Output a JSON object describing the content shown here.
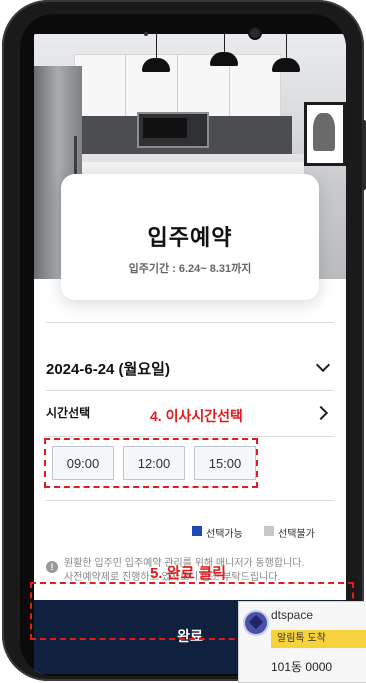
{
  "page": {
    "title": "입주예약",
    "period": "입주기간 : 6.24~ 8.31까지"
  },
  "date": {
    "selected": "2024-6-24 (월요일)"
  },
  "time": {
    "label": "시간선택",
    "slots": [
      "09:00",
      "12:00",
      "15:00"
    ]
  },
  "legend": {
    "available": "선택가능",
    "unavailable": "선택불가",
    "available_color": "#1f49b5",
    "unavailable_color": "#c8c8c8"
  },
  "notice": {
    "line1": "원활한 입주민 입주예약 관리를 위해 매니저가 동행합니다.",
    "line2": "사전예약제로 진행하고 있사오니 협조 부탁드립니다."
  },
  "footer": {
    "done_label": "완료",
    "bg_color": "#10203f"
  },
  "annotations": {
    "step4": "4. 이사시간선택",
    "step5": "5. 완료 클릭",
    "color": "#e21b1b"
  },
  "notification": {
    "app": "dtspace",
    "badge": "알림톡 도착",
    "body": "101동 0000"
  }
}
